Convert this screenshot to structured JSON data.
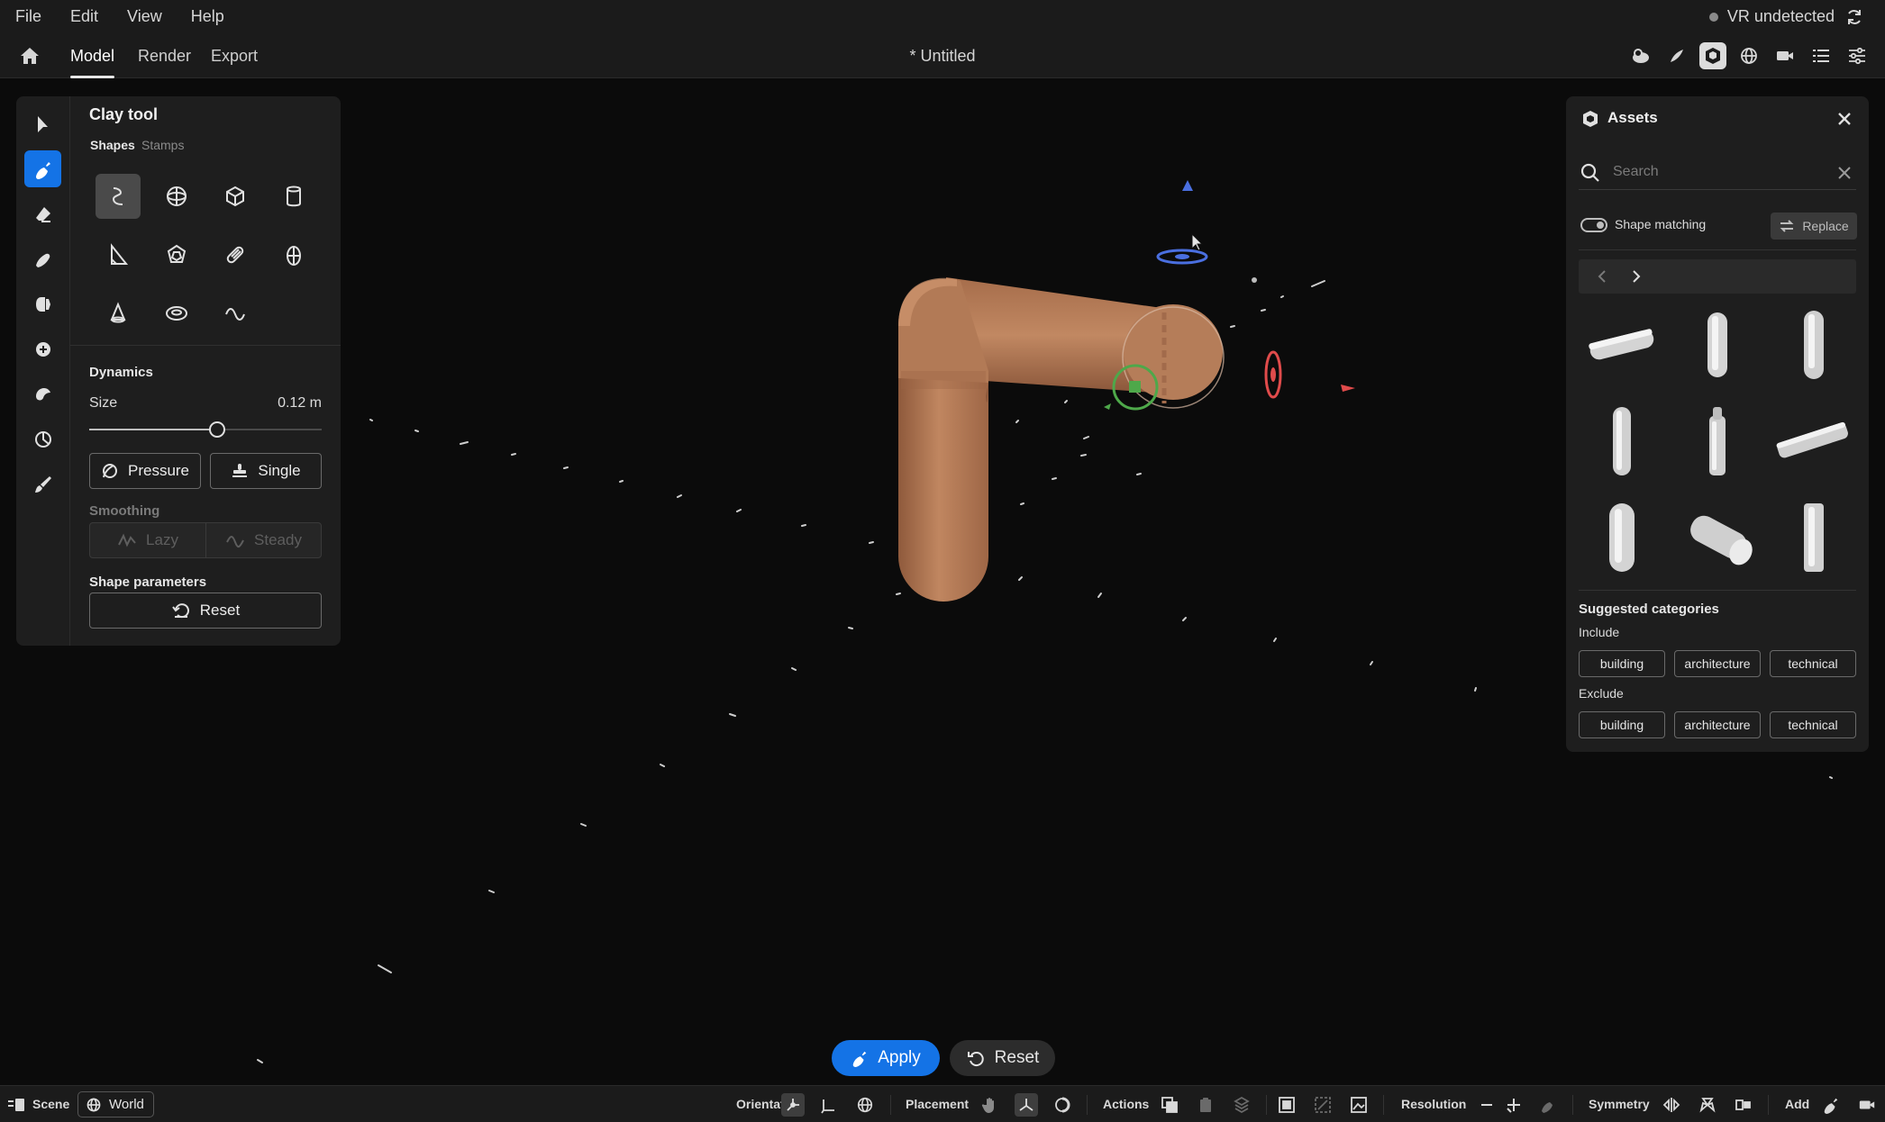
{
  "menubar": {
    "items": [
      "File",
      "Edit",
      "View",
      "Help"
    ],
    "vr_status": "VR undetected"
  },
  "toolbar": {
    "tabs": [
      "Model",
      "Render",
      "Export"
    ],
    "active_tab": "Model",
    "doc_title": "* Untitled",
    "right_icons": [
      "environment-icon",
      "sculpt-icon",
      "model-icon",
      "globe-icon",
      "camera-icon",
      "layers-icon",
      "settings-sliders-icon"
    ]
  },
  "tools": {
    "rail": [
      "select-icon",
      "clay-icon",
      "erase-icon",
      "smooth-icon",
      "move-icon",
      "transform-icon",
      "stamp-icon",
      "mask-icon",
      "paint-icon"
    ],
    "active": "clay-icon"
  },
  "clay_panel": {
    "title": "Clay tool",
    "subtabs": [
      "Shapes",
      "Stamps"
    ],
    "active_subtab": "Shapes",
    "shapes": [
      "stroke-shape-icon",
      "sphere-shape-icon",
      "cube-shape-icon",
      "cylinder-shape-icon",
      "wedge-shape-icon",
      "polyhedron-shape-icon",
      "capsule-shape-icon",
      "egg-shape-icon",
      "cone-shape-icon",
      "torus-shape-icon",
      "wave-shape-icon"
    ],
    "dynamics_title": "Dynamics",
    "size_label": "Size",
    "size_value": "0.12 m",
    "size_fraction": 0.55,
    "pressure_label": "Pressure",
    "single_label": "Single",
    "smoothing_label": "Smoothing",
    "lazy_label": "Lazy",
    "steady_label": "Steady",
    "shape_params_title": "Shape parameters",
    "reset_label": "Reset"
  },
  "assets": {
    "title": "Assets",
    "search_placeholder": "Search",
    "shape_matching_label": "Shape matching",
    "shape_matching_on": true,
    "replace_label": "Replace",
    "suggested_title": "Suggested categories",
    "include_label": "Include",
    "exclude_label": "Exclude",
    "include_chips": [
      "building",
      "architecture",
      "technical"
    ],
    "exclude_chips": [
      "building",
      "architecture",
      "technical"
    ]
  },
  "actions": {
    "apply_label": "Apply",
    "reset_label": "Reset"
  },
  "statusbar": {
    "scene_label": "Scene",
    "world_label": "World",
    "orientation_label": "Orientation",
    "placement_label": "Placement",
    "actions_label": "Actions",
    "resolution_label": "Resolution",
    "symmetry_label": "Symmetry",
    "add_label": "Add"
  },
  "colors": {
    "accent": "#1473e6",
    "clay": "#b97a55",
    "gizmo_x": "#e04b4b",
    "gizmo_y": "#4ea84a",
    "gizmo_z": "#4a6fe0"
  }
}
